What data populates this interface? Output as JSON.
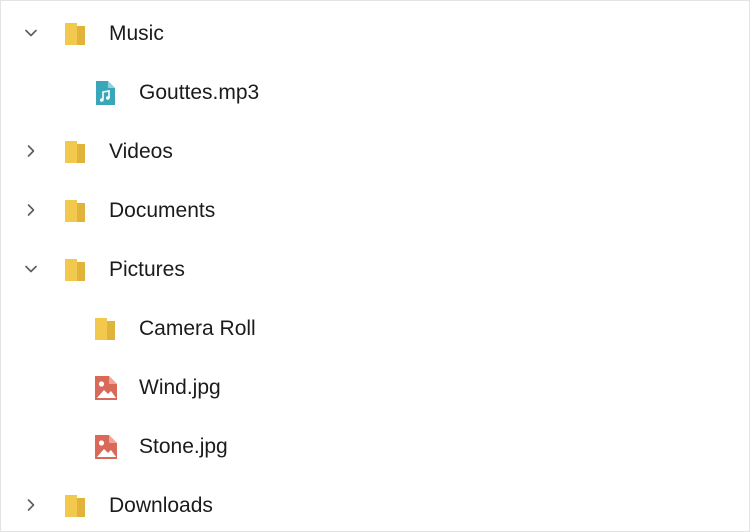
{
  "tree": {
    "items": [
      {
        "label": "Music",
        "level": 0,
        "type": "folder",
        "state": "expanded",
        "icon": "folder-icon"
      },
      {
        "label": "Gouttes.mp3",
        "level": 1,
        "type": "audio",
        "icon": "audio-file-icon"
      },
      {
        "label": "Videos",
        "level": 0,
        "type": "folder",
        "state": "collapsed",
        "icon": "folder-icon"
      },
      {
        "label": "Documents",
        "level": 0,
        "type": "folder",
        "state": "collapsed",
        "icon": "folder-icon"
      },
      {
        "label": "Pictures",
        "level": 0,
        "type": "folder",
        "state": "expanded",
        "icon": "folder-icon"
      },
      {
        "label": "Camera Roll",
        "level": 1,
        "type": "folder",
        "icon": "folder-icon"
      },
      {
        "label": "Wind.jpg",
        "level": 1,
        "type": "image",
        "icon": "image-file-icon"
      },
      {
        "label": "Stone.jpg",
        "level": 1,
        "type": "image",
        "icon": "image-file-icon"
      },
      {
        "label": "Downloads",
        "level": 0,
        "type": "folder",
        "state": "collapsed",
        "icon": "folder-icon"
      }
    ]
  },
  "colors": {
    "folder": "#f2c94c",
    "folder_dark": "#e0b33a",
    "audio": "#3aa6b9",
    "image": "#d96a5a",
    "chevron": "#5c5c5c",
    "text": "#1b1b1b"
  }
}
